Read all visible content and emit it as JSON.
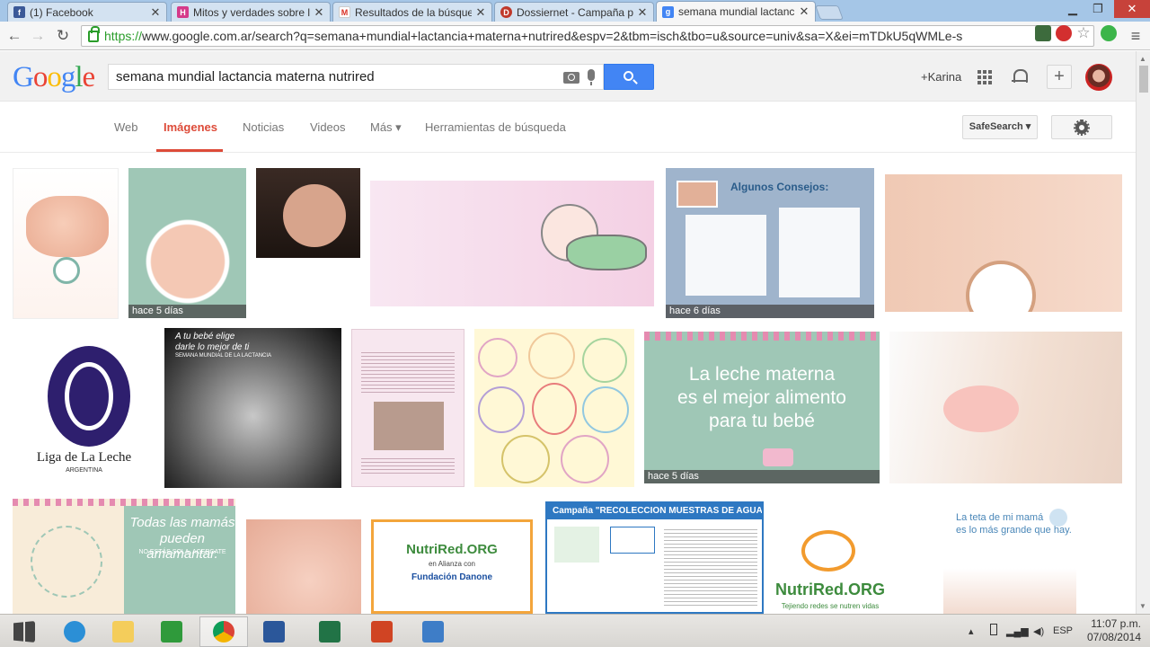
{
  "browser": {
    "tabs": [
      {
        "title": "(1) Facebook",
        "favicon": "facebook-icon",
        "color": "#3b5998",
        "glyph": "f"
      },
      {
        "title": "Mitos y verdades sobre la",
        "favicon": "h-icon",
        "color": "#d53a8a",
        "glyph": "H"
      },
      {
        "title": "Resultados de la búsqued",
        "favicon": "gmail-icon",
        "color": "#d93025",
        "glyph": "M"
      },
      {
        "title": "Dossiernet - Campaña po",
        "favicon": "dossiernet-icon",
        "color": "#c0392b",
        "glyph": "D"
      },
      {
        "title": "semana mundial lactancia",
        "favicon": "google-icon",
        "color": "#4285f4",
        "glyph": "g"
      }
    ],
    "url_scheme": "https://",
    "url_rest": "www.google.com.ar/search?q=semana+mundial+lactancia+materna+nutrired&espv=2&tbm=isch&tbo=u&source=univ&sa=X&ei=mTDkU5qWMLe-s"
  },
  "google": {
    "logo_letters": [
      {
        "ch": "G",
        "color": "#4285f4"
      },
      {
        "ch": "o",
        "color": "#ea4335"
      },
      {
        "ch": "o",
        "color": "#fbbc05"
      },
      {
        "ch": "g",
        "color": "#4285f4"
      },
      {
        "ch": "l",
        "color": "#34a853"
      },
      {
        "ch": "e",
        "color": "#ea4335"
      }
    ],
    "query": "semana mundial lactancia materna nutrired",
    "user": "+Karina",
    "nav": [
      "Web",
      "Imágenes",
      "Noticias",
      "Videos",
      "Más ▾",
      "Herramientas de búsqueda"
    ],
    "safesearch": "SafeSearch ▾"
  },
  "images": {
    "ages": [
      "hace 5 días",
      "hace 6 días",
      "hace 5 días"
    ],
    "captions": {
      "t_liga": "Liga de La Leche",
      "t_liga_sub": "ARGENTINA",
      "t_leche1": "La leche materna",
      "t_leche2": "es el mejor alimento",
      "t_leche3": "para tu bebé",
      "t_consejos": "Algunos Consejos:",
      "t_todas1": "Todas las mamás",
      "t_todas2": "pueden amamantar.",
      "t_todas3": "NO ESTÁS SOLA. ACERCATE",
      "t_bebe1": "A tu bebé elige",
      "t_bebe2": "darle lo mejor de ti",
      "t_bebe3": "SEMANA MUNDIAL DE LA LACTANCIA",
      "t_campana": "Campaña \"RECOLECCION MUESTRAS DE AGUAS\"",
      "t_nutrired": "NutriRed.ORG",
      "t_nutrired_sub": "Tejiendo redes se nutren vidas",
      "t_nutri_alianza": "en Alianza con",
      "t_danone": "Fundación Danone",
      "t_teta1": "La teta de mi mamá",
      "t_teta2": "es lo más grande que hay."
    }
  },
  "taskbar": {
    "lang": "ESP",
    "time": "11:07 p.m.",
    "date": "07/08/2014"
  }
}
